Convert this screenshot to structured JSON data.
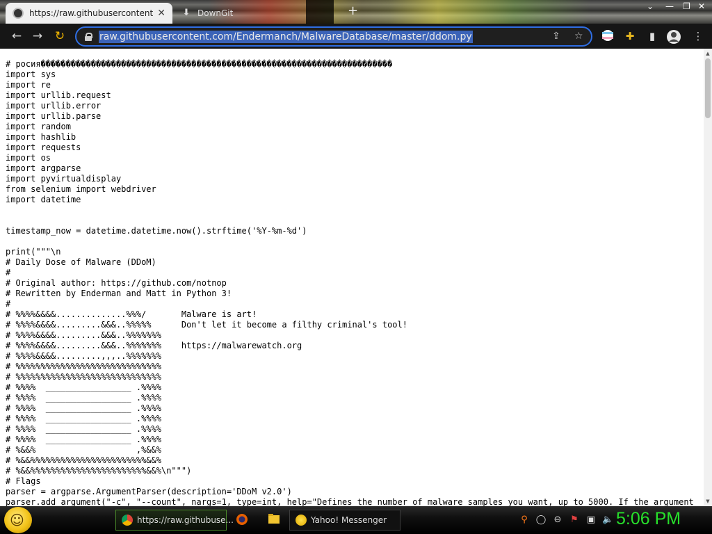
{
  "browser": {
    "tabs": [
      {
        "title": "https://raw.githubusercontent.com",
        "active": true,
        "icon": "github-icon"
      },
      {
        "title": "DownGit",
        "active": false,
        "icon": "download-icon"
      }
    ],
    "url": "raw.githubusercontent.com/Endermanch/MalwareDatabase/master/ddom.py",
    "toolbar_icons": [
      "back-arrow-icon",
      "forward-arrow-icon",
      "reload-icon",
      "lock-icon",
      "share-icon",
      "star-icon",
      "profile-flag-icon",
      "extensions-puzzle-icon",
      "side-panel-icon",
      "account-avatar-icon",
      "menu-dots-icon"
    ]
  },
  "code_lines": [
    "# росия����������������������������������������������������������������������",
    "import sys",
    "import re",
    "import urllib.request",
    "import urllib.error",
    "import urllib.parse",
    "import random",
    "import hashlib",
    "import requests",
    "import os",
    "import argparse",
    "import pyvirtualdisplay",
    "from selenium import webdriver",
    "import datetime",
    "",
    "",
    "timestamp_now = datetime.datetime.now().strftime('%Y-%m-%d')",
    "",
    "print(\"\"\"\\n",
    "# Daily Dose of Malware (DDoM)",
    "#",
    "# Original author: https://github.com/notnop",
    "# Rewritten by Enderman and Matt in Python 3!",
    "#",
    "# %%%%&&&&..............%%%/       Malware is art!",
    "# %%%%&&&&.........&&&..%%%%%      Don't let it become a filthy criminal's tool!",
    "# %%%%&&&&.........&&&..%%%%%%%",
    "# %%%%&&&&.........&&&..%%%%%%%    https://malwarewatch.org",
    "# %%%%&&&&.........,,,..%%%%%%%",
    "# %%%%%%%%%%%%%%%%%%%%%%%%%%%%%",
    "# %%%%%%%%%%%%%%%%%%%%%%%%%%%%%",
    "# %%%%  _________________ .%%%%",
    "# %%%%  _________________ .%%%%",
    "# %%%%  _________________ .%%%%",
    "# %%%%  _________________ .%%%%",
    "# %%%%  _________________ .%%%%",
    "# %%%%  _________________ .%%%%",
    "# %&&%                    ,%&&%",
    "# %&&%%%%%%%%%%%%%%%%%%%%%%%&&%",
    "# %&&%%%%%%%%%%%%%%%%%%%%%%%&&%\\n\"\"\")",
    "# Flags",
    "parser = argparse.ArgumentParser(description='DDoM v2.0')",
    "parser.add_argument(\"-c\", \"--count\", nargs=1, type=int, help=\"Defines the number of malware samples you want, up to 5000. If the argument"
  ],
  "taskbar": {
    "start_icon": "smiley-start-orb-icon",
    "items": [
      {
        "label": "https://raw.githubuse...",
        "icon": "chrome-icon",
        "active": true
      },
      {
        "label": "Yahoo! Messenger",
        "icon": "yahoo-messenger-icon",
        "active": false
      }
    ],
    "pinned": [
      "firefox-icon",
      "file-explorer-icon"
    ],
    "tray": [
      "search-magnifier-icon",
      "lens-icon",
      "minus-circle-icon",
      "flag-icon",
      "network-icon",
      "volume-icon"
    ],
    "clock": "5:06 PM"
  }
}
